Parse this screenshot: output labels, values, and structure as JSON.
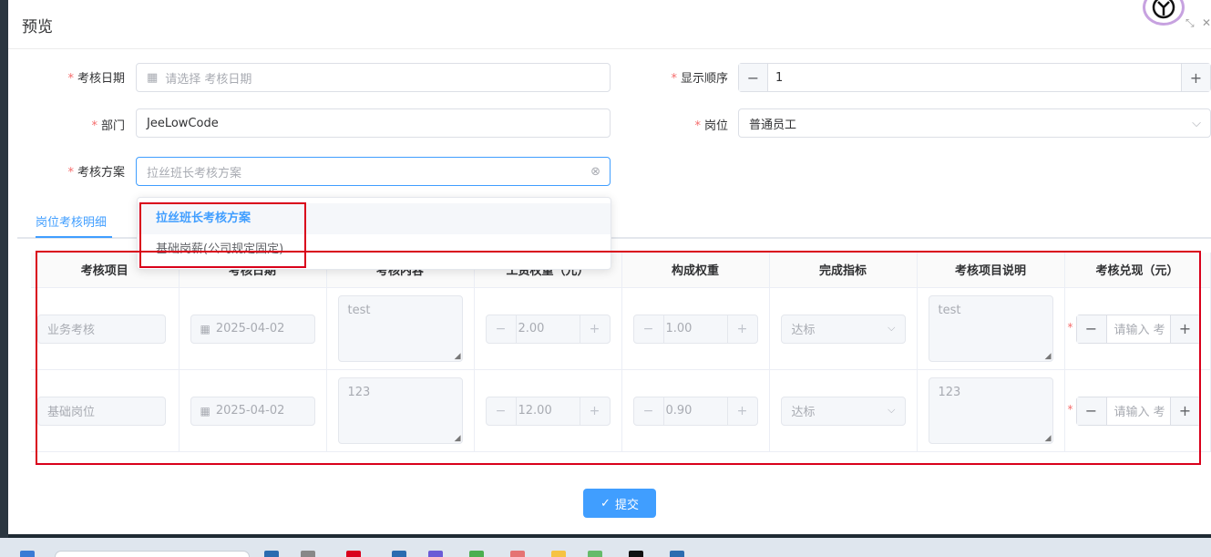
{
  "dialog": {
    "title": "预览"
  },
  "form": {
    "required_mark": "*",
    "date_label": "考核日期",
    "date_placeholder": "请选择 考核日期",
    "order_label": "显示顺序",
    "order_value": "1",
    "dept_label": "部门",
    "dept_value": "JeeLowCode",
    "post_label": "岗位",
    "post_value": "普通员工",
    "plan_label": "考核方案",
    "plan_placeholder": "拉丝班长考核方案",
    "plan_options": [
      {
        "label": "拉丝班长考核方案",
        "selected": true
      },
      {
        "label": "基础岗薪(公司规定固定)",
        "selected": false
      }
    ]
  },
  "tabs": [
    {
      "label": "岗位考核明细",
      "active": true
    }
  ],
  "table": {
    "headers": [
      "考核项目",
      "考核日期",
      "考核内容",
      "工资权重（元）",
      "构成权重",
      "完成指标",
      "考核项目说明",
      "考核兑现（元）"
    ],
    "rows": [
      {
        "item": "业务考核",
        "date": "2025-04-02",
        "content": "test",
        "salary_weight": "2.00",
        "composition_weight": "1.00",
        "target": "达标",
        "description": "test",
        "payout_placeholder": "请输入 考"
      },
      {
        "item": "基础岗位",
        "date": "2025-04-02",
        "content": "123",
        "salary_weight": "12.00",
        "composition_weight": "0.90",
        "target": "达标",
        "description": "123",
        "payout_placeholder": "请输入 考"
      }
    ]
  },
  "submit_label": "提交",
  "icons": {
    "calendar": "calendar-icon",
    "clear": "circle-close-icon",
    "chevron": "chevron-down-icon",
    "minus": "minus-icon",
    "plus": "plus-icon",
    "check": "check-icon",
    "minimize": "minimize-icon",
    "close": "close-icon"
  },
  "colors": {
    "primary": "#409eff",
    "danger": "#f56c6c",
    "highlight_border": "#d9001b"
  }
}
